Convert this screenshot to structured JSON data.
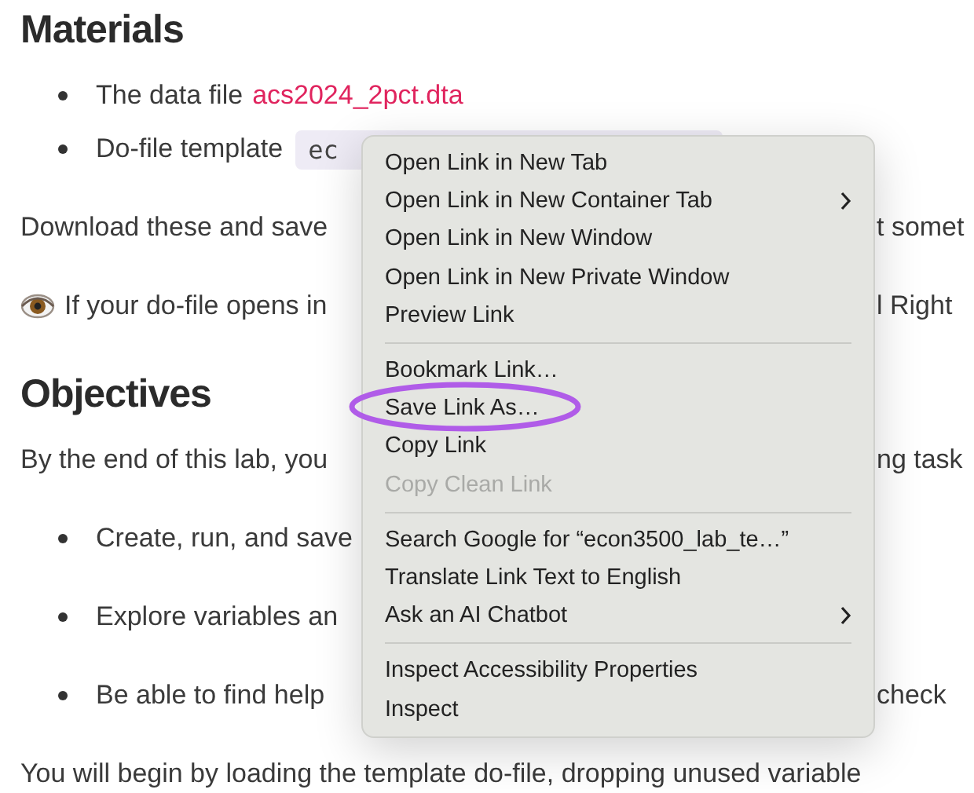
{
  "document": {
    "blocks": [
      {
        "kind": "heading",
        "text": "Materials"
      },
      {
        "kind": "list",
        "items": [
          {
            "parts": [
              {
                "kind": "text",
                "text": "The data file"
              },
              {
                "kind": "link",
                "text": "acs2024_2pct.dta"
              }
            ]
          },
          {
            "parts": [
              {
                "kind": "text",
                "text": "Do-file template"
              },
              {
                "kind": "code",
                "text": "ec"
              }
            ]
          }
        ]
      },
      {
        "kind": "para",
        "text": "Download these and save",
        "right": "t somet"
      },
      {
        "kind": "note",
        "text": "If your do-file opens in",
        "right": "l Right"
      },
      {
        "kind": "heading",
        "text": "Objectives"
      },
      {
        "kind": "para",
        "text": "By the end of this lab, you",
        "right": "ng task"
      },
      {
        "kind": "list",
        "items": [
          {
            "parts": [
              {
                "kind": "text",
                "text": "Create, run, and save"
              }
            ]
          },
          {
            "parts": [
              {
                "kind": "text",
                "text": "Explore variables an"
              }
            ]
          },
          {
            "parts": [
              {
                "kind": "text",
                "text": "Be able to find help"
              }
            ],
            "right": "check"
          }
        ]
      },
      {
        "kind": "para",
        "text": "You will begin by loading the template do-file, dropping unused variable"
      }
    ]
  },
  "context_menu": {
    "items": [
      {
        "kind": "item",
        "label": "Open Link in New Tab",
        "disabled": false
      },
      {
        "kind": "item",
        "label": "Open Link in New Container Tab",
        "disabled": false,
        "submenu": true
      },
      {
        "kind": "item",
        "label": "Open Link in New Window",
        "disabled": false
      },
      {
        "kind": "item",
        "label": "Open Link in New Private Window",
        "disabled": false
      },
      {
        "kind": "item",
        "label": "Preview Link",
        "disabled": false
      },
      {
        "kind": "separator"
      },
      {
        "kind": "item",
        "label": "Bookmark Link…",
        "disabled": false
      },
      {
        "kind": "item",
        "label": "Save Link As…",
        "disabled": false,
        "circled": true
      },
      {
        "kind": "item",
        "label": "Copy Link",
        "disabled": false
      },
      {
        "kind": "item",
        "label": "Copy Clean Link",
        "disabled": true
      },
      {
        "kind": "separator"
      },
      {
        "kind": "item",
        "label": "Search Google for “econ3500_lab_te…”",
        "disabled": false
      },
      {
        "kind": "item",
        "label": "Translate Link Text to English",
        "disabled": false
      },
      {
        "kind": "item",
        "label": "Ask an AI Chatbot",
        "disabled": false,
        "submenu": true
      },
      {
        "kind": "separator"
      },
      {
        "kind": "item",
        "label": "Inspect Accessibility Properties",
        "disabled": false
      },
      {
        "kind": "item",
        "label": "Inspect",
        "disabled": false
      }
    ]
  }
}
